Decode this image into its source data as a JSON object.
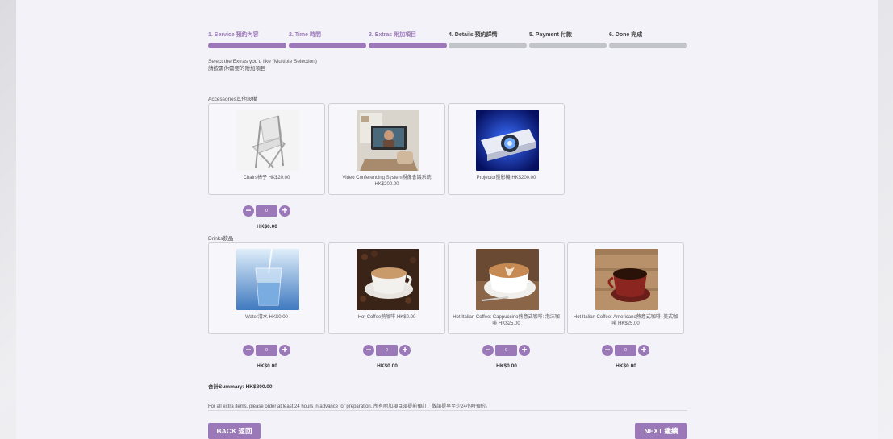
{
  "steps": [
    {
      "label": "1. Service 預約內容",
      "state": "done"
    },
    {
      "label": "2. Time 時間",
      "state": "done"
    },
    {
      "label": "3. Extras 附加項目",
      "state": "done"
    },
    {
      "label": "4. Details 預約詳情",
      "state": "todo"
    },
    {
      "label": "5. Payment 付款",
      "state": "todo"
    },
    {
      "label": "6. Done 完成",
      "state": "todo"
    }
  ],
  "intro": {
    "line1": "Select the Extras you'd like (Multiple Selection)",
    "line2": "請按需你需要的附加項目"
  },
  "sections": {
    "accessories": {
      "label": "Accessories其他設備",
      "items": [
        {
          "caption": "Chairs椅子 HK$20.00",
          "qty": "0",
          "subtotal": "HK$0.00"
        },
        {
          "caption": "Video Conferencing System視像會議系統 HK$200.00"
        },
        {
          "caption": "Projector投影機 HK$200.00"
        }
      ]
    },
    "drinks": {
      "label": "Drinks飲品",
      "items": [
        {
          "caption": "Water清水 HK$0.00",
          "qty": "0",
          "subtotal": "HK$0.00"
        },
        {
          "caption": "Hot Coffee熱咖啡 HK$0.00",
          "qty": "0",
          "subtotal": "HK$0.00"
        },
        {
          "caption": "Hot Italian Coffee: Cappuccino熱意式咖啡: 泡沫咖啡 HK$25.00",
          "qty": "0",
          "subtotal": "HK$0.00"
        },
        {
          "caption": "Hot Italian Coffee: Americano熱意式咖啡: 美式咖啡 HK$25.00",
          "qty": "0",
          "subtotal": "HK$0.00"
        }
      ]
    }
  },
  "qty_controls": {
    "minus": "−",
    "plus": "+"
  },
  "summary": "合計Summary: HK$800.00",
  "notice": "For all extra items, please order at least 24 hours in advance for preparation. 所有附加項目須提前預訂，敬請提早至少24小時預約。",
  "buttons": {
    "back": "BACK 返回",
    "next": "NEXT 繼續"
  },
  "icons": {
    "chairs": "folding-chair-photo",
    "video": "video-conference-photo",
    "projector": "projector-photo",
    "water": "water-glass-photo",
    "hot_coffee": "coffee-cup-photo",
    "cappuccino": "cappuccino-photo",
    "americano": "americano-photo"
  },
  "colors": {
    "accent": "#9b78b8",
    "inactive": "#c3c4ca",
    "panel": "#f3f2f9"
  }
}
